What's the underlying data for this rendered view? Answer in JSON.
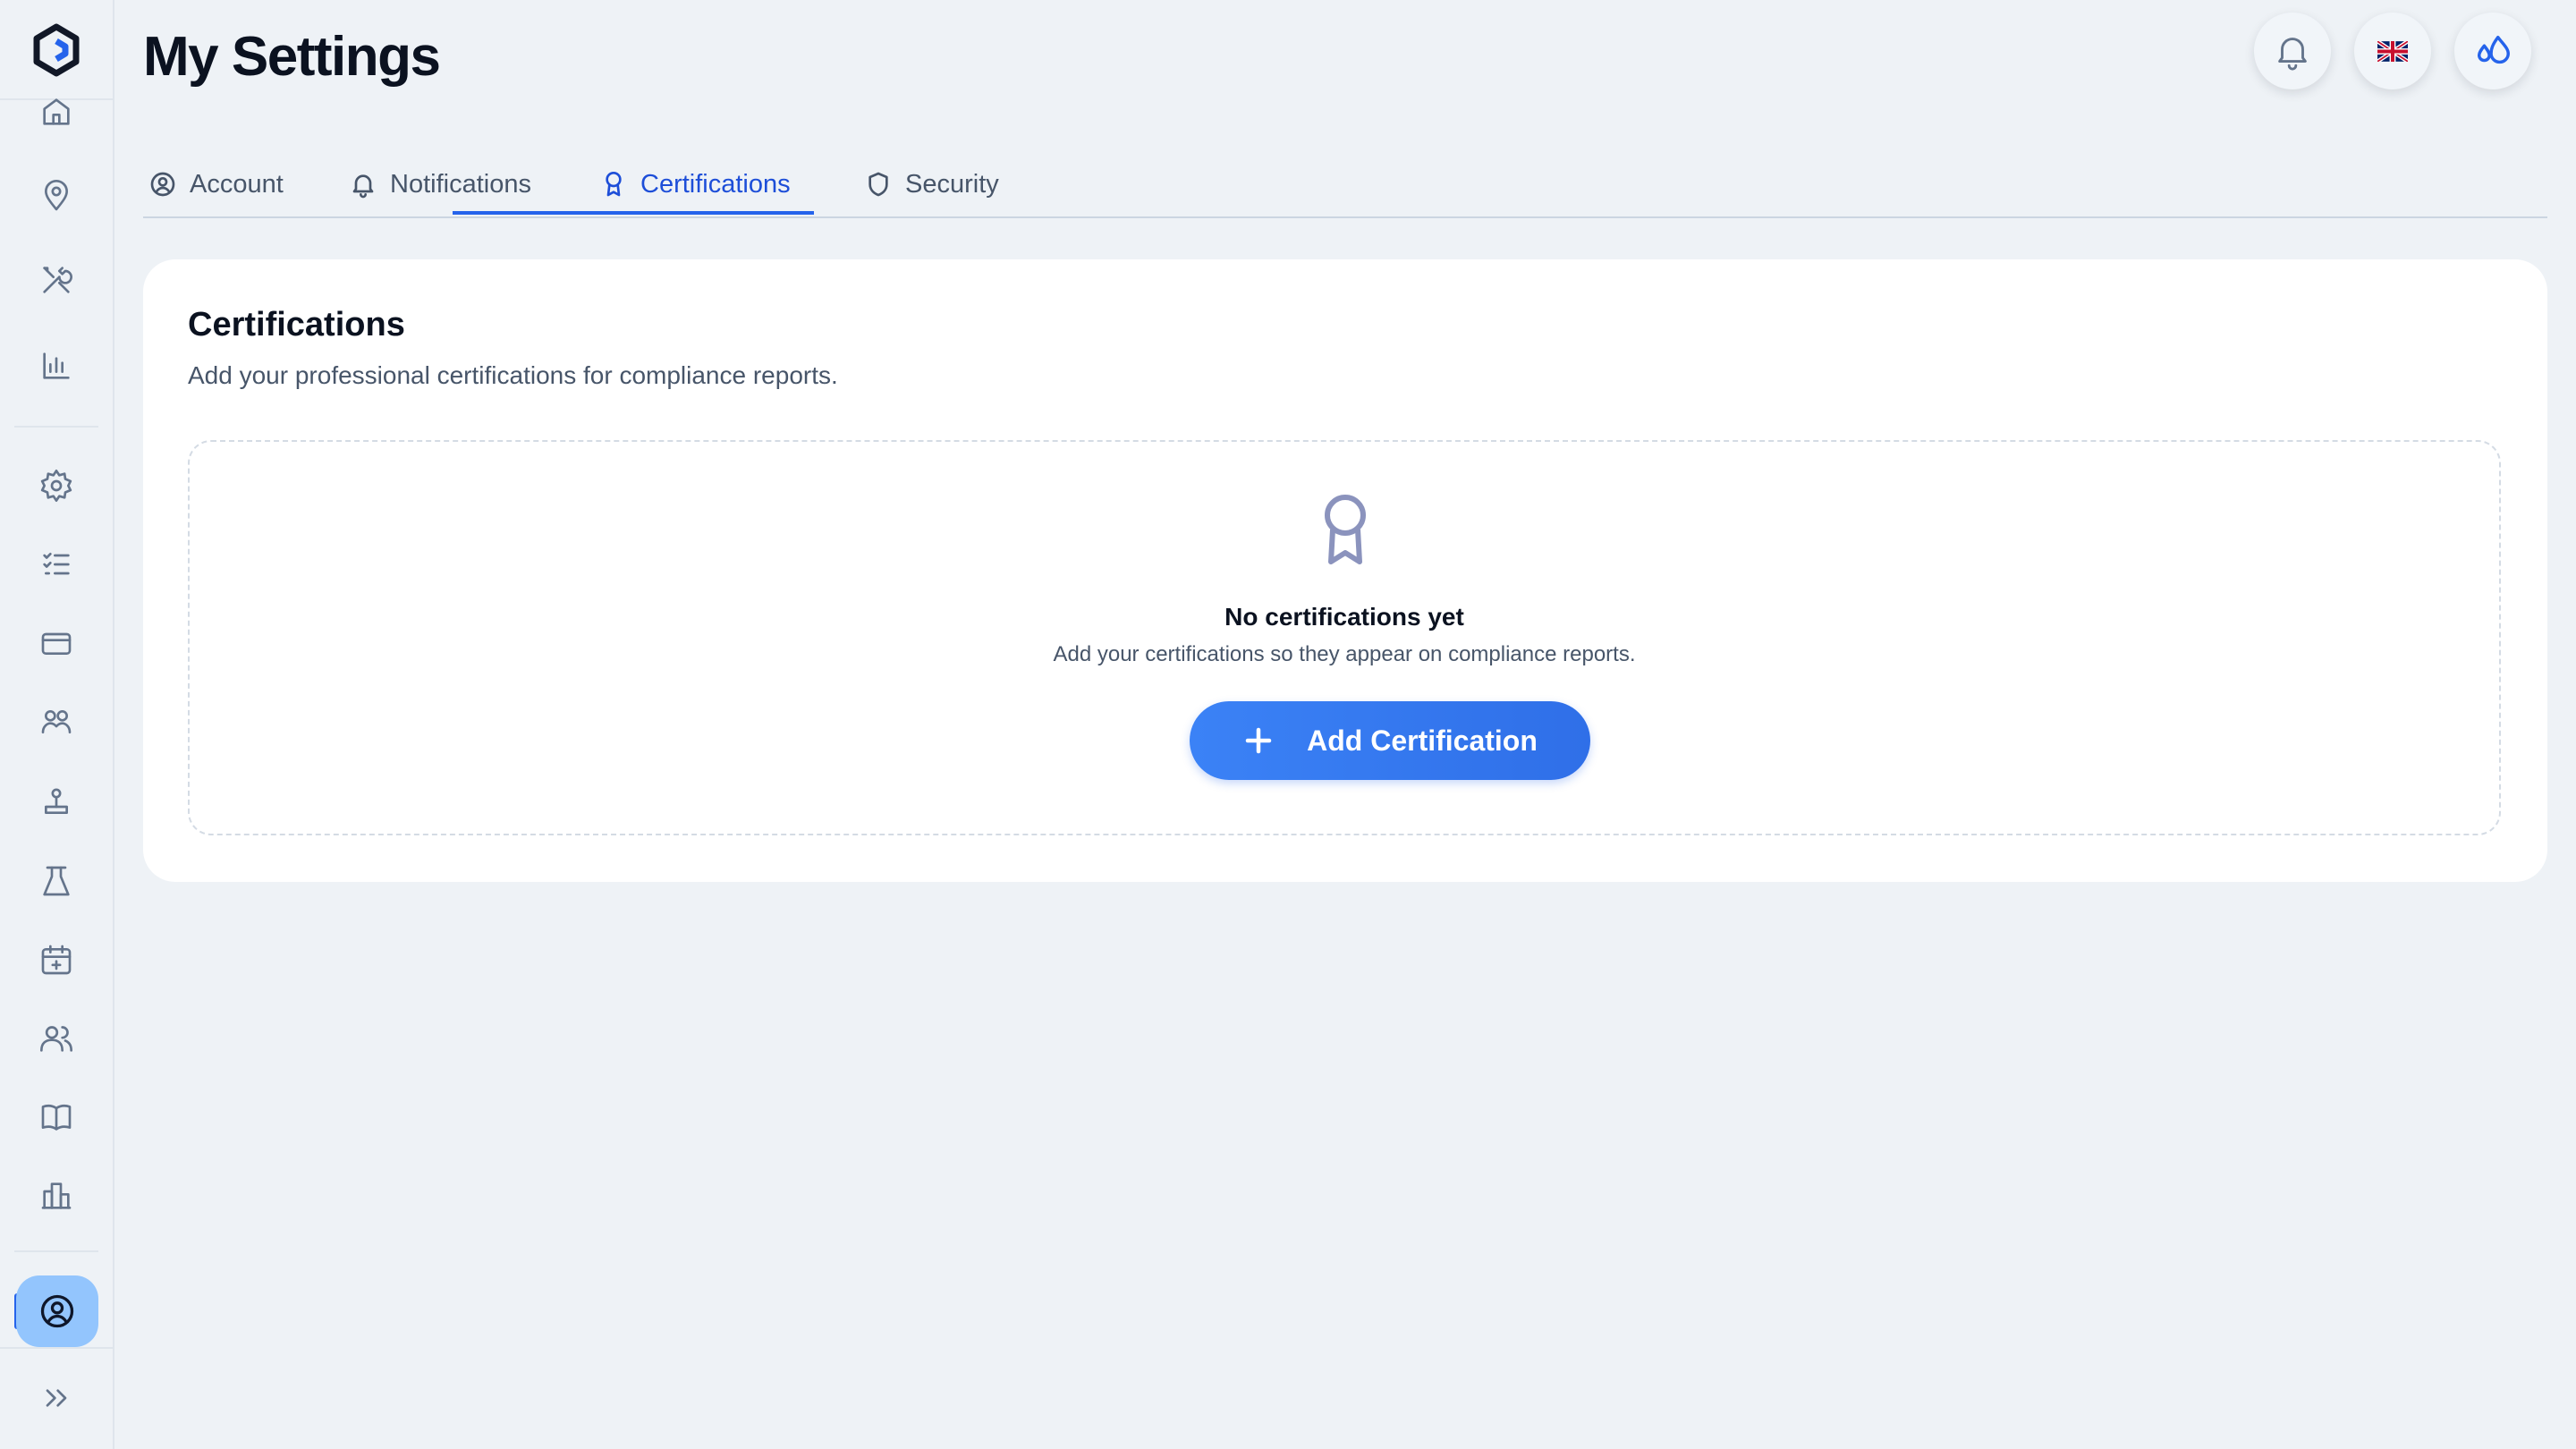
{
  "page": {
    "title": "My Settings"
  },
  "header": {
    "language_flag_icon": "uk-flag-icon",
    "notification_icon": "bell-icon",
    "theme_icon": "water-drop-icon"
  },
  "tabs": [
    {
      "label": "Account",
      "icon": "user-circle-icon",
      "active": false
    },
    {
      "label": "Notifications",
      "icon": "bell-icon",
      "active": false
    },
    {
      "label": "Certifications",
      "icon": "award-icon",
      "active": true
    },
    {
      "label": "Security",
      "icon": "shield-icon",
      "active": false
    }
  ],
  "certifications": {
    "title": "Certifications",
    "subtitle": "Add your professional certifications for compliance reports.",
    "empty_title": "No certifications yet",
    "empty_subtitle": "Add your certifications so they appear on compliance reports.",
    "add_button_label": "Add Certification"
  },
  "sidebar": {
    "items": [
      "home-icon",
      "location-pin-icon",
      "tools-icon",
      "bar-chart-icon",
      "gear-icon",
      "checklist-icon",
      "credit-card-icon",
      "group-icon",
      "joystick-icon",
      "lab-flask-icon",
      "calendar-plus-icon",
      "users-icon",
      "book-icon",
      "buildings-icon"
    ],
    "active_item": "profile-icon",
    "expand_icon": "chevrons-right-icon"
  },
  "colors": {
    "accent": "#2563eb",
    "background": "#eef2f6",
    "card": "#ffffff"
  }
}
